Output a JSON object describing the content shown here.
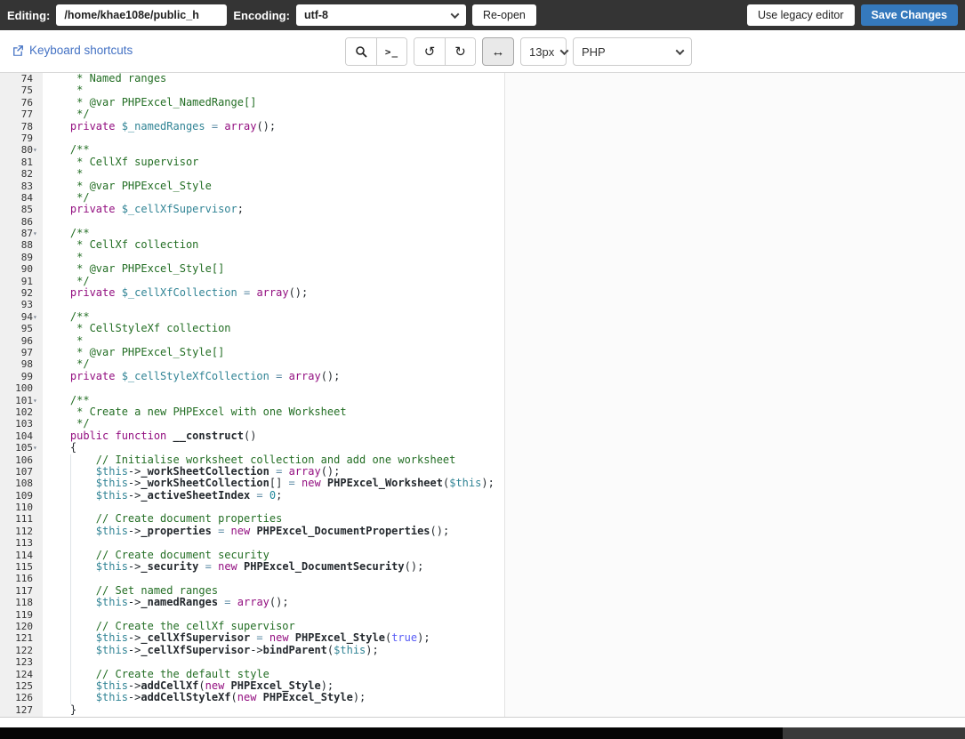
{
  "header": {
    "editing_label": "Editing:",
    "file_path": "/home/khae108e/public_h",
    "encoding_label": "Encoding:",
    "encoding_value": "utf-8",
    "reopen_label": "Re-open",
    "legacy_editor_label": "Use legacy editor",
    "save_label": "Save Changes"
  },
  "toolbar": {
    "shortcuts_label": "Keyboard shortcuts",
    "font_size_value": "13px",
    "syntax_mode_value": "PHP",
    "icons": {
      "terminal": ">_",
      "undo": "↺",
      "redo": "↻",
      "word_wrap": "↔"
    }
  },
  "colors": {
    "topbar_bg": "#343434",
    "save_button": "#3579bd",
    "link_blue": "#4472c4",
    "comment": "#236e24",
    "keyword": "#930f80",
    "variable": "#318495",
    "identifier": "#24292e",
    "number": "#1d8599",
    "boolean": "#585cf6",
    "operator": "#5e8ca6"
  },
  "editor": {
    "first_line_number": 74,
    "last_line_number": 127,
    "fold_line_numbers": [
      80,
      87,
      94,
      101,
      105
    ],
    "fold_glyph": "▾",
    "lines": [
      [
        [
          "c",
          "     * Named ranges"
        ]
      ],
      [
        [
          "c",
          "     *"
        ]
      ],
      [
        [
          "c",
          "     * @var PHPExcel_NamedRange[]"
        ]
      ],
      [
        [
          "c",
          "     */"
        ]
      ],
      [
        [
          "k",
          "    private"
        ],
        [
          "v",
          " $_namedRanges"
        ],
        [
          "o",
          " = "
        ],
        [
          "k",
          "array"
        ],
        [
          "p",
          "();"
        ]
      ],
      [],
      [
        [
          "c",
          "    /**"
        ]
      ],
      [
        [
          "c",
          "     * CellXf supervisor"
        ]
      ],
      [
        [
          "c",
          "     *"
        ]
      ],
      [
        [
          "c",
          "     * @var PHPExcel_Style"
        ]
      ],
      [
        [
          "c",
          "     */"
        ]
      ],
      [
        [
          "k",
          "    private"
        ],
        [
          "v",
          " $_cellXfSupervisor"
        ],
        [
          "p",
          ";"
        ]
      ],
      [],
      [
        [
          "c",
          "    /**"
        ]
      ],
      [
        [
          "c",
          "     * CellXf collection"
        ]
      ],
      [
        [
          "c",
          "     *"
        ]
      ],
      [
        [
          "c",
          "     * @var PHPExcel_Style[]"
        ]
      ],
      [
        [
          "c",
          "     */"
        ]
      ],
      [
        [
          "k",
          "    private"
        ],
        [
          "v",
          " $_cellXfCollection"
        ],
        [
          "o",
          " = "
        ],
        [
          "k",
          "array"
        ],
        [
          "p",
          "();"
        ]
      ],
      [],
      [
        [
          "c",
          "    /**"
        ]
      ],
      [
        [
          "c",
          "     * CellStyleXf collection"
        ]
      ],
      [
        [
          "c",
          "     *"
        ]
      ],
      [
        [
          "c",
          "     * @var PHPExcel_Style[]"
        ]
      ],
      [
        [
          "c",
          "     */"
        ]
      ],
      [
        [
          "k",
          "    private"
        ],
        [
          "v",
          " $_cellStyleXfCollection"
        ],
        [
          "o",
          " = "
        ],
        [
          "k",
          "array"
        ],
        [
          "p",
          "();"
        ]
      ],
      [],
      [
        [
          "c",
          "    /**"
        ]
      ],
      [
        [
          "c",
          "     * Create a new PHPExcel with one Worksheet"
        ]
      ],
      [
        [
          "c",
          "     */"
        ]
      ],
      [
        [
          "k",
          "    public function"
        ],
        [
          "i",
          " __construct"
        ],
        [
          "p",
          "()"
        ]
      ],
      [
        [
          "p",
          "    {"
        ]
      ],
      [
        [
          "c",
          "        // Initialise worksheet collection and add one worksheet"
        ]
      ],
      [
        [
          "v",
          "        $this"
        ],
        [
          "p",
          "->"
        ],
        [
          "i",
          "_workSheetCollection"
        ],
        [
          "o",
          " = "
        ],
        [
          "k",
          "array"
        ],
        [
          "p",
          "();"
        ]
      ],
      [
        [
          "v",
          "        $this"
        ],
        [
          "p",
          "->"
        ],
        [
          "i",
          "_workSheetCollection"
        ],
        [
          "p",
          "[]"
        ],
        [
          "o",
          " = "
        ],
        [
          "k",
          "new"
        ],
        [
          "i",
          " PHPExcel_Worksheet"
        ],
        [
          "p",
          "("
        ],
        [
          "v",
          "$this"
        ],
        [
          "p",
          ");"
        ]
      ],
      [
        [
          "v",
          "        $this"
        ],
        [
          "p",
          "->"
        ],
        [
          "i",
          "_activeSheetIndex"
        ],
        [
          "o",
          " = "
        ],
        [
          "n",
          "0"
        ],
        [
          "p",
          ";"
        ]
      ],
      [],
      [
        [
          "c",
          "        // Create document properties"
        ]
      ],
      [
        [
          "v",
          "        $this"
        ],
        [
          "p",
          "->"
        ],
        [
          "i",
          "_properties"
        ],
        [
          "o",
          " = "
        ],
        [
          "k",
          "new"
        ],
        [
          "i",
          " PHPExcel_DocumentProperties"
        ],
        [
          "p",
          "();"
        ]
      ],
      [],
      [
        [
          "c",
          "        // Create document security"
        ]
      ],
      [
        [
          "v",
          "        $this"
        ],
        [
          "p",
          "->"
        ],
        [
          "i",
          "_security"
        ],
        [
          "o",
          " = "
        ],
        [
          "k",
          "new"
        ],
        [
          "i",
          " PHPExcel_DocumentSecurity"
        ],
        [
          "p",
          "();"
        ]
      ],
      [],
      [
        [
          "c",
          "        // Set named ranges"
        ]
      ],
      [
        [
          "v",
          "        $this"
        ],
        [
          "p",
          "->"
        ],
        [
          "i",
          "_namedRanges"
        ],
        [
          "o",
          " = "
        ],
        [
          "k",
          "array"
        ],
        [
          "p",
          "();"
        ]
      ],
      [],
      [
        [
          "c",
          "        // Create the cellXf supervisor"
        ]
      ],
      [
        [
          "v",
          "        $this"
        ],
        [
          "p",
          "->"
        ],
        [
          "i",
          "_cellXfSupervisor"
        ],
        [
          "o",
          " = "
        ],
        [
          "k",
          "new"
        ],
        [
          "i",
          " PHPExcel_Style"
        ],
        [
          "p",
          "("
        ],
        [
          "b",
          "true"
        ],
        [
          "p",
          ");"
        ]
      ],
      [
        [
          "v",
          "        $this"
        ],
        [
          "p",
          "->"
        ],
        [
          "i",
          "_cellXfSupervisor"
        ],
        [
          "p",
          "->"
        ],
        [
          "i",
          "bindParent"
        ],
        [
          "p",
          "("
        ],
        [
          "v",
          "$this"
        ],
        [
          "p",
          ");"
        ]
      ],
      [],
      [
        [
          "c",
          "        // Create the default style"
        ]
      ],
      [
        [
          "v",
          "        $this"
        ],
        [
          "p",
          "->"
        ],
        [
          "i",
          "addCellXf"
        ],
        [
          "p",
          "("
        ],
        [
          "k",
          "new"
        ],
        [
          "i",
          " PHPExcel_Style"
        ],
        [
          "p",
          ");"
        ]
      ],
      [
        [
          "v",
          "        $this"
        ],
        [
          "p",
          "->"
        ],
        [
          "i",
          "addCellStyleXf"
        ],
        [
          "p",
          "("
        ],
        [
          "k",
          "new"
        ],
        [
          "i",
          " PHPExcel_Style"
        ],
        [
          "p",
          ");"
        ]
      ],
      [
        [
          "p",
          "    }"
        ]
      ]
    ]
  }
}
